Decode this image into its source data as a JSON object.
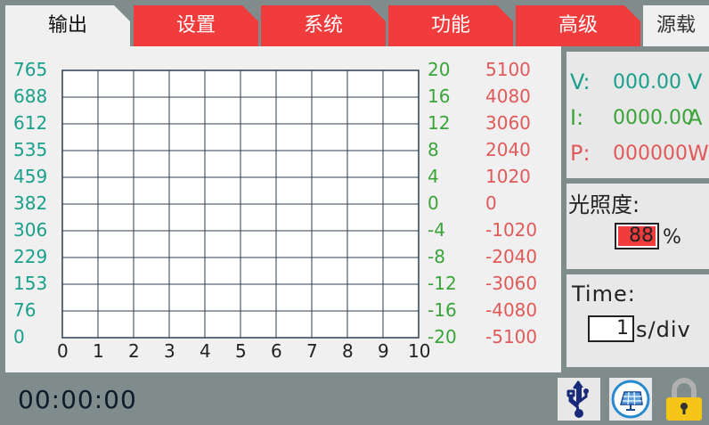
{
  "tabs": [
    {
      "label": "输出",
      "active": true
    },
    {
      "label": "设置",
      "active": false
    },
    {
      "label": "系统",
      "active": false
    },
    {
      "label": "功能",
      "active": false
    },
    {
      "label": "高级",
      "active": false
    },
    {
      "label": "源载",
      "active": false
    }
  ],
  "chart_data": {
    "type": "line",
    "x_ticks": [
      "0",
      "1",
      "2",
      "3",
      "4",
      "5",
      "6",
      "7",
      "8",
      "9",
      "10"
    ],
    "xlim": [
      0,
      10
    ],
    "y_axes": [
      {
        "ticks": [
          "765",
          "688",
          "612",
          "535",
          "459",
          "382",
          "306",
          "229",
          "153",
          "76",
          "0"
        ],
        "ylim": [
          0,
          765
        ],
        "color": "#1aa08a"
      },
      {
        "ticks": [
          "20",
          "16",
          "12",
          "8",
          "4",
          "0",
          "-4",
          "-8",
          "-12",
          "-16",
          "-20"
        ],
        "ylim": [
          -20,
          20
        ],
        "color": "#3aa43a"
      },
      {
        "ticks": [
          "5100",
          "4080",
          "3060",
          "2040",
          "1020",
          "0",
          "-1020",
          "-2040",
          "-3060",
          "-4080",
          "-5100"
        ],
        "ylim": [
          -5100,
          5100
        ],
        "color": "#e05a5a"
      }
    ],
    "grid": true,
    "series": []
  },
  "readouts": {
    "v_label": "V:",
    "v_value": "000.00",
    "v_unit": "V",
    "i_label": "I:",
    "i_value": "0000.00",
    "i_unit": "A",
    "p_label": "P:",
    "p_value": "000000",
    "p_unit": "W"
  },
  "illuminance": {
    "label": "光照度:",
    "value": "88",
    "unit": "%"
  },
  "time": {
    "label": "Time:",
    "value": "1",
    "unit": "s/div"
  },
  "status": {
    "clock": "00:00:00"
  },
  "colors": {
    "tab_red": "#f03c3c",
    "accent_teal": "#1aa08a",
    "accent_green": "#3aa43a",
    "accent_red": "#e05a5a"
  },
  "icons": [
    "usb-icon",
    "solar-panel-icon",
    "lock-icon"
  ]
}
